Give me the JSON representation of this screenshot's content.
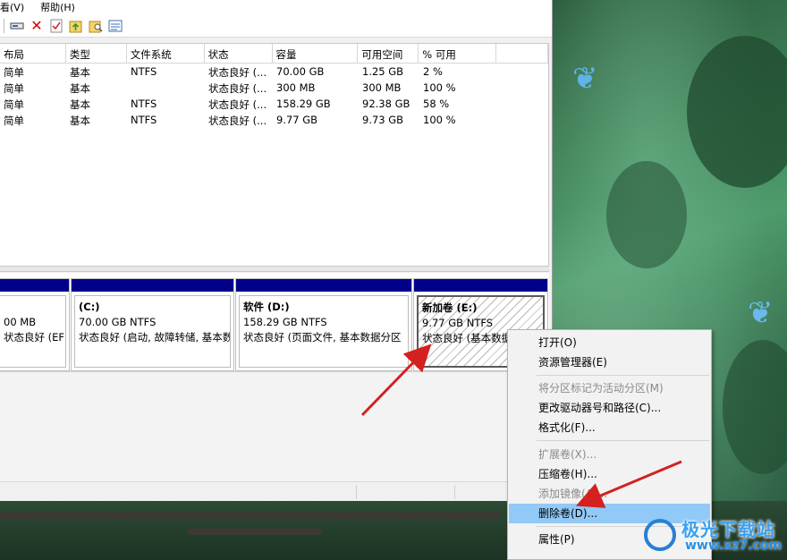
{
  "menubar": {
    "items": [
      "看(V)",
      "帮助(H)"
    ]
  },
  "toolbar": {
    "icons": [
      "properties-icon",
      "delete-icon",
      "check-icon",
      "folder-up-icon",
      "search-folder-icon",
      "list-icon"
    ]
  },
  "volume_list": {
    "columns": [
      "布局",
      "类型",
      "文件系统",
      "状态",
      "容量",
      "可用空间",
      "% 可用"
    ],
    "rows": [
      [
        "简单",
        "基本",
        "NTFS",
        "状态良好 (...",
        "70.00 GB",
        "1.25 GB",
        "2 %"
      ],
      [
        "简单",
        "基本",
        "",
        "状态良好 (...",
        "300 MB",
        "300 MB",
        "100 %"
      ],
      [
        "简单",
        "基本",
        "NTFS",
        "状态良好 (...",
        "158.29 GB",
        "92.38 GB",
        "58 %"
      ],
      [
        "简单",
        "基本",
        "NTFS",
        "状态良好 (...",
        "9.77 GB",
        "9.73 GB",
        "100 %"
      ]
    ]
  },
  "disk_map": {
    "volumes": [
      {
        "name": "",
        "size": "00 MB",
        "status": "状态良好 (EFI"
      },
      {
        "name": "(C:)",
        "size": "70.00 GB NTFS",
        "status": "状态良好 (启动, 故障转储, 基本数"
      },
      {
        "name": "软件  (D:)",
        "size": "158.29 GB NTFS",
        "status": "状态良好 (页面文件, 基本数据分区"
      },
      {
        "name": "新加卷  (E:)",
        "size": "9.77 GB NTFS",
        "status": "状态良好 (基本数据分"
      }
    ]
  },
  "context_menu": {
    "items": [
      {
        "label": "打开(O)",
        "disabled": false
      },
      {
        "label": "资源管理器(E)",
        "disabled": false
      },
      {
        "label": "将分区标记为活动分区(M)",
        "disabled": true
      },
      {
        "label": "更改驱动器号和路径(C)...",
        "disabled": false
      },
      {
        "label": "格式化(F)...",
        "disabled": false
      },
      {
        "label": "扩展卷(X)...",
        "disabled": true
      },
      {
        "label": "压缩卷(H)...",
        "disabled": false
      },
      {
        "label": "添加镜像(A)...",
        "disabled": true
      },
      {
        "label": "删除卷(D)...",
        "disabled": false,
        "highlighted": true
      },
      {
        "label": "属性(P)",
        "disabled": false
      }
    ]
  },
  "watermark": {
    "brand": "极光下载站",
    "url": "www.xz7.com"
  },
  "colors": {
    "volume_header": "#00008a",
    "menu_highlight": "#91c9f7",
    "arrow": "#d42020"
  }
}
